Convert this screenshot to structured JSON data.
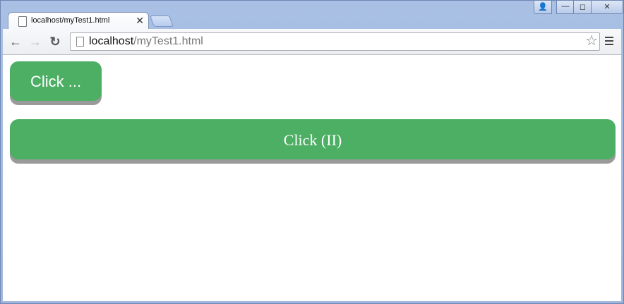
{
  "browser": {
    "tab": {
      "title": "localhost/myTest1.html",
      "close": "✕"
    },
    "window_controls": {
      "user": "👤",
      "minimize": "—",
      "maximize": "◻",
      "close": "✕"
    },
    "nav": {
      "back": "←",
      "forward": "→",
      "reload": "↻"
    },
    "omnibox": {
      "host": "localhost",
      "path": "/myTest1.html",
      "star": "☆"
    }
  },
  "page": {
    "button1_label": "Click ...",
    "button2_label": "Click (II)"
  },
  "colors": {
    "button_green": "#4caf64",
    "button_shadow": "#9a9a9a"
  }
}
